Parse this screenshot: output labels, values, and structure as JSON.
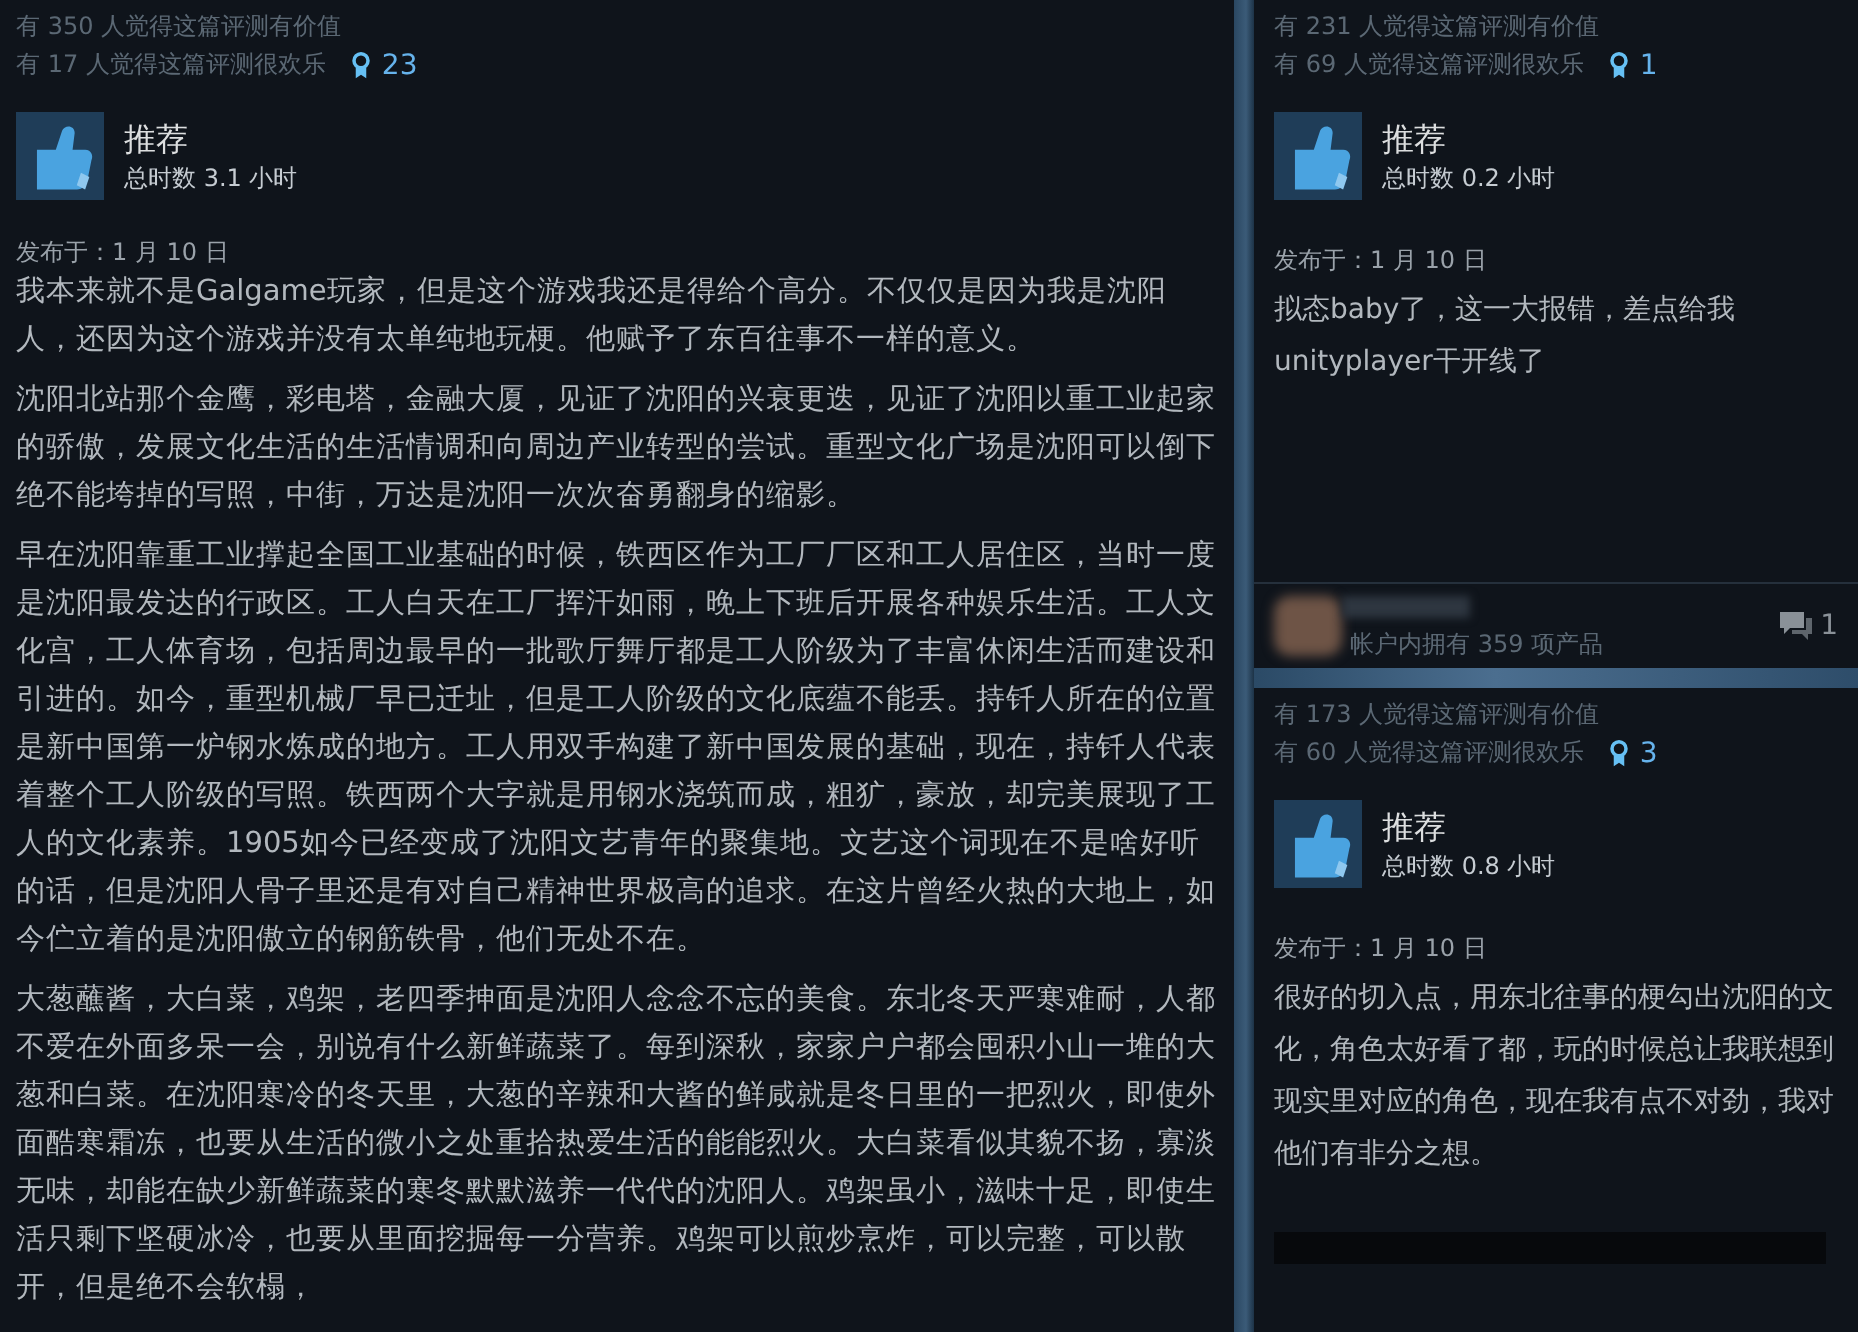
{
  "main_review": {
    "helpful": "有 350 人觉得这篇评测有价值",
    "funny": "有 17 人觉得这篇评测很欢乐",
    "awards": "23",
    "verdict": "推荐",
    "hours": "总时数 3.1 小时",
    "posted": "发布于：1 月 10 日",
    "paragraphs": [
      "我本来就不是Galgame玩家，但是这个游戏我还是得给个高分。不仅仅是因为我是沈阳人，还因为这个游戏并没有太单纯地玩梗。他赋予了东百往事不一样的意义。",
      "沈阳北站那个金鹰，彩电塔，金融大厦，见证了沈阳的兴衰更迭，见证了沈阳以重工业起家的骄傲，发展文化生活的生活情调和向周边产业转型的尝试。重型文化广场是沈阳可以倒下绝不能垮掉的写照，中街，万达是沈阳一次次奋勇翻身的缩影。",
      "早在沈阳靠重工业撑起全国工业基础的时候，铁西区作为工厂厂区和工人居住区，当时一度是沈阳最发达的行政区。工人白天在工厂挥汗如雨，晚上下班后开展各种娱乐生活。工人文化宫，工人体育场，包括周边最早的一批歌厅舞厅都是工人阶级为了丰富休闲生活而建设和引进的。如今，重型机械厂早已迁址，但是工人阶级的文化底蕴不能丢。持钎人所在的位置是新中国第一炉钢水炼成的地方。工人用双手构建了新中国发展的基础，现在，持钎人代表着整个工人阶级的写照。铁西两个大字就是用钢水浇筑而成，粗犷，豪放，却完美展现了工人的文化素养。1905如今已经变成了沈阳文艺青年的聚集地。文艺这个词现在不是啥好听的话，但是沈阳人骨子里还是有对自己精神世界极高的追求。在这片曾经火热的大地上，如今伫立着的是沈阳傲立的钢筋铁骨，他们无处不在。",
      "大葱蘸酱，大白菜，鸡架，老四季抻面是沈阳人念念不忘的美食。东北冬天严寒难耐，人都不爱在外面多呆一会，别说有什么新鲜蔬菜了。每到深秋，家家户户都会囤积小山一堆的大葱和白菜。在沈阳寒冷的冬天里，大葱的辛辣和大酱的鲜咸就是冬日里的一把烈火，即使外面酷寒霜冻，也要从生活的微小之处重拾热爱生活的能能烈火。大白菜看似其貌不扬，寡淡无味，却能在缺少新鲜蔬菜的寒冬默默滋养一代代的沈阳人。鸡架虽小，滋味十足，即使生活只剩下坚硬冰冷，也要从里面挖掘每一分营养。鸡架可以煎炒烹炸，可以完整，可以散开，但是绝不会软榻，"
    ]
  },
  "side_reviews": [
    {
      "helpful": "有 231 人觉得这篇评测有价值",
      "funny": "有 69 人觉得这篇评测很欢乐",
      "awards": "1",
      "verdict": "推荐",
      "hours": "总时数 0.2 小时",
      "posted": "发布于：1 月 10 日",
      "paragraphs": [
        "拟态baby了，这一大报错，差点给我unityplayer干开线了"
      ],
      "owned_products": "帐户内拥有 359 项产品",
      "comments": "1"
    },
    {
      "helpful": "有 173 人觉得这篇评测有价值",
      "funny": "有 60 人觉得这篇评测很欢乐",
      "awards": "3",
      "verdict": "推荐",
      "hours": "总时数 0.8 小时",
      "posted": "发布于：1 月 10 日",
      "paragraphs": [
        "很好的切入点，用东北往事的梗勾出沈阳的文化，角色太好看了都，玩的时候总让我联想到现实里对应的角色，现在我有点不对劲，我对他们有非分之想。"
      ]
    }
  ]
}
